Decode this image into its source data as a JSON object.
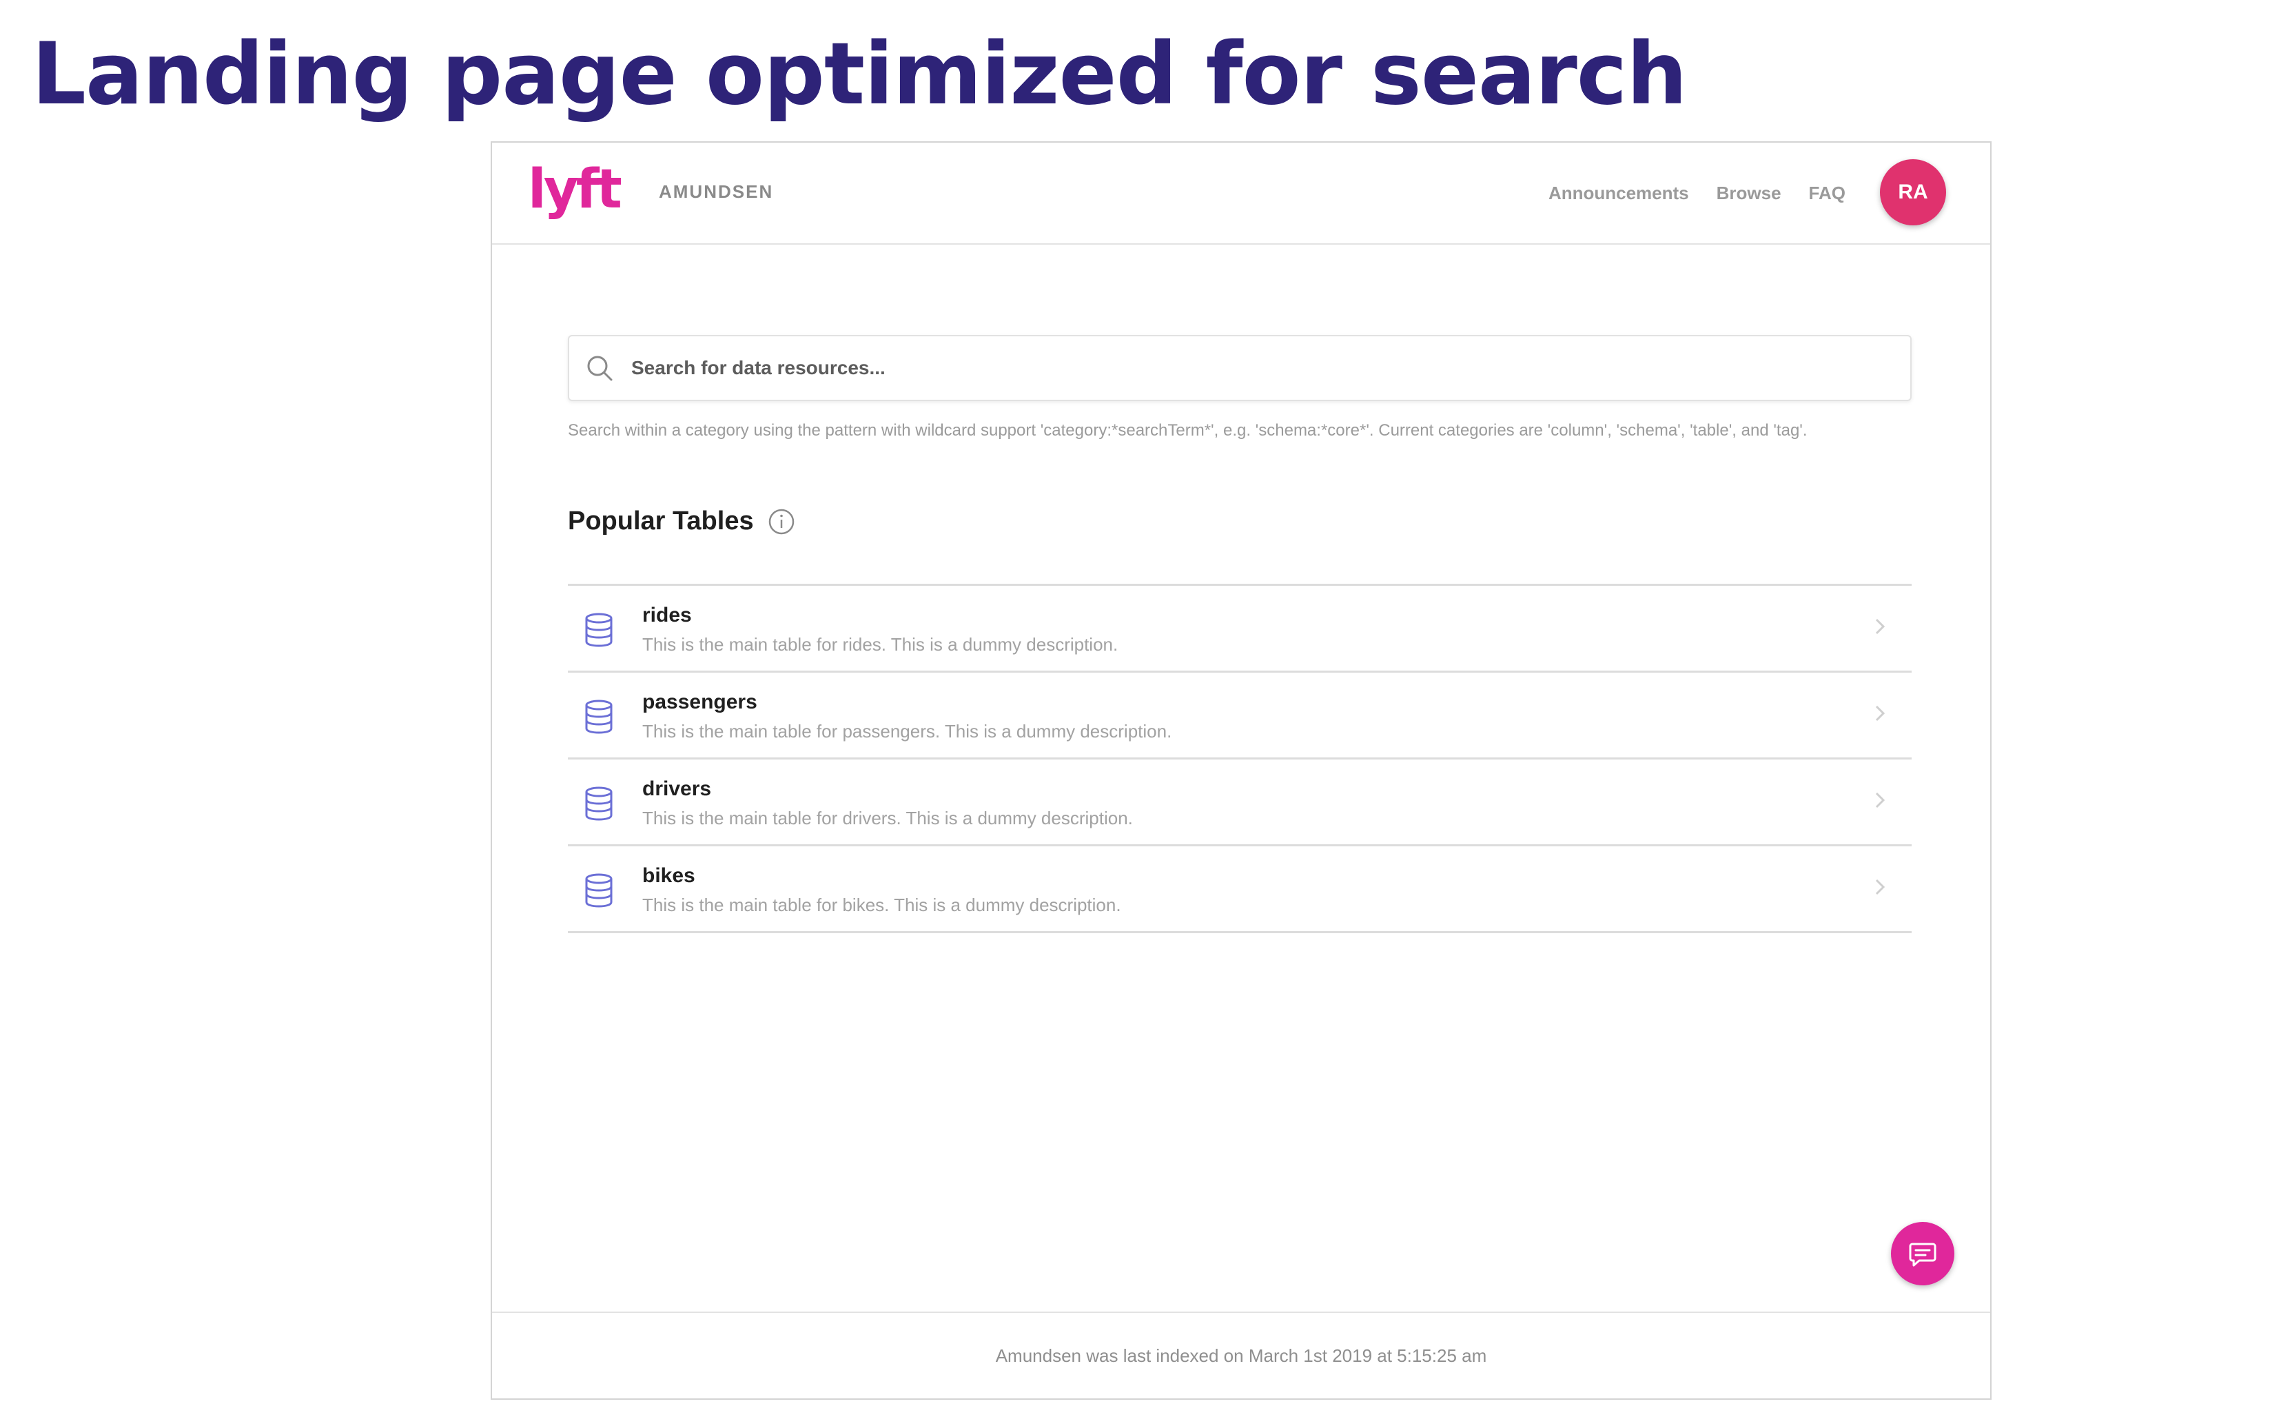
{
  "slide": {
    "title": "Landing page optimized for search"
  },
  "navbar": {
    "brand": "AMUNDSEN",
    "logo": "lyft-logo",
    "links": [
      "Announcements",
      "Browse",
      "FAQ"
    ],
    "avatar_initials": "RA"
  },
  "search": {
    "placeholder": "Search for data resources...",
    "hint": "Search within a category using the pattern with wildcard support 'category:*searchTerm*', e.g. 'schema:*core*'. Current categories are 'column', 'schema', 'table', and 'tag'.",
    "icon": "search-icon"
  },
  "popular_tables": {
    "title": "Popular Tables",
    "info_icon": "info-icon",
    "rows": [
      {
        "name": "rides",
        "description": "This is the main table for rides. This is a dummy description."
      },
      {
        "name": "passengers",
        "description": "This is the main table for passengers. This is a dummy description."
      },
      {
        "name": "drivers",
        "description": "This is the main table for drivers. This is a dummy description."
      },
      {
        "name": "bikes",
        "description": "This is the main table for bikes. This is a dummy description."
      }
    ]
  },
  "footer": {
    "text": "Amundsen was last indexed on March 1st 2019 at 5:15:25 am"
  },
  "colors": {
    "title": "#2e2378",
    "brand_pink": "#e0279b",
    "avatar": "#e0326e",
    "db_icon": "#6b6fd6"
  }
}
